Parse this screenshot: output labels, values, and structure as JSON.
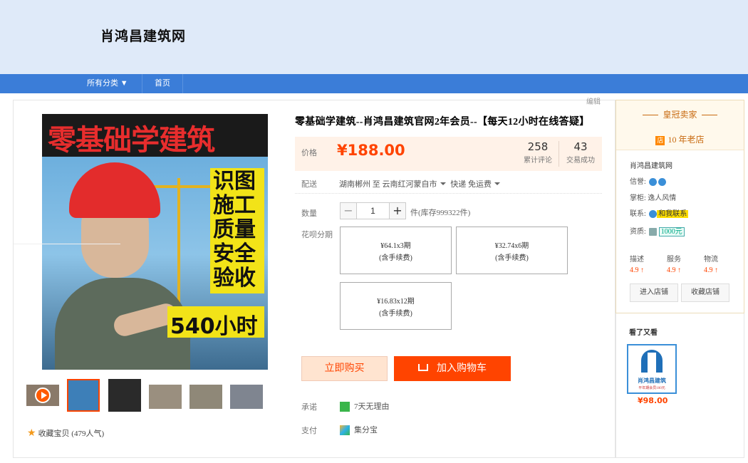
{
  "shop": {
    "title": "肖鸿昌建筑网"
  },
  "nav": {
    "all_categories": "所有分类 ▼",
    "home": "首页"
  },
  "edit": "编辑",
  "image": {
    "banner": "零基础学建筑",
    "side_text": "识图施工质量安全验收",
    "hours": "540小时"
  },
  "collect": {
    "icon": "star-icon",
    "label": "收藏宝贝 (479人气)"
  },
  "product": {
    "title": "零基础学建筑--肖鸿昌建筑官网2年会员--【每天12小时在线答疑】",
    "price_label": "价格",
    "price": "¥188.00",
    "reviews_count": "258",
    "reviews_label": "累计评论",
    "deals_count": "43",
    "deals_label": "交易成功",
    "delivery_label": "配送",
    "delivery_from": "湖南郴州 至",
    "delivery_to": "云南红河蒙自市",
    "delivery_method": "快递 免运费",
    "qty_label": "数量",
    "qty_minus": "−",
    "qty_value": "1",
    "qty_plus": "+",
    "stock": "件(库存999322件)",
    "installment_label": "花呗分期",
    "installments": [
      {
        "amount": "¥64.1x3期",
        "fee": "(含手续费)"
      },
      {
        "amount": "¥32.74x6期",
        "fee": "(含手续费)"
      },
      {
        "amount": "¥16.83x12期",
        "fee": "(含手续费)"
      }
    ],
    "buy_now": "立即购买",
    "add_cart": "加入购物车",
    "promise_label": "承诺",
    "promise": "7天无理由",
    "pay_label": "支付",
    "pay": "集分宝"
  },
  "seller": {
    "crown": "皇冠卖家",
    "old_shop": "10 年老店",
    "name": "肖鸿昌建筑网",
    "credit_label": "信誉:",
    "keeper_label": "掌柜:",
    "keeper": "逸人风情",
    "contact_label": "联系:",
    "contact": "和我联系",
    "qual_label": "资质:",
    "qual": "1000元",
    "dsr": [
      {
        "label": "描述",
        "score": "4.9 ↑"
      },
      {
        "label": "服务",
        "score": "4.9 ↑"
      },
      {
        "label": "物流",
        "score": "4.9 ↑"
      }
    ],
    "enter_shop": "进入店铺",
    "fav_shop": "收藏店铺"
  },
  "also": {
    "title": "看了又看",
    "item_logo": "肖鸿昌建筑",
    "item_sub": "平年期会员100元",
    "item_price": "¥98.00"
  },
  "colors": {
    "accent": "#ff4400",
    "nav": "#3b7dd8",
    "header_bg": "#dfeaf9"
  }
}
